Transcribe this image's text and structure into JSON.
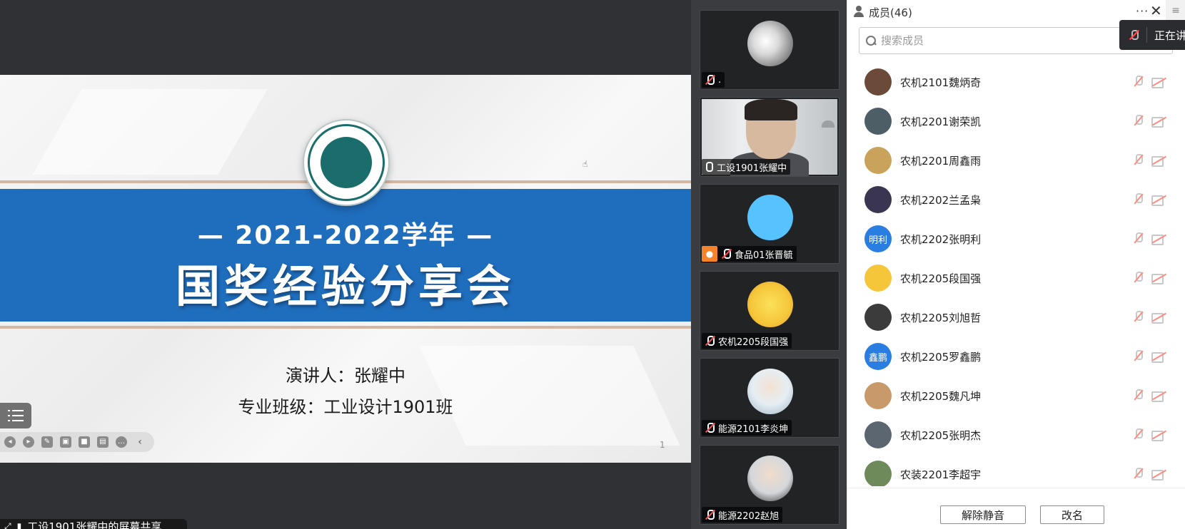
{
  "slide": {
    "year_line": "— 2021-2022学年 —",
    "title": "国奖经验分享会",
    "speaker": "演讲人：张耀中",
    "class": "专业班级：工业设计1901班",
    "page_number": "1"
  },
  "share_label": "工设1901张耀中的屏幕共享",
  "video_tiles": [
    {
      "name": ".",
      "mic": "muted",
      "avatar_color": "#cfcfcf"
    },
    {
      "name": "工设1901张耀中",
      "mic": "on",
      "video": true
    },
    {
      "name": "食品01张晋毓",
      "mic": "muted",
      "avatar_color": "#56c3ff",
      "badge": "person"
    },
    {
      "name": "农机2205段国强",
      "mic": "muted",
      "avatar_color": "#f5c63a"
    },
    {
      "name": "能源2101李炎坤",
      "mic": "muted",
      "avatar_color": "#e6eef3"
    },
    {
      "name": "能源2202赵旭",
      "mic": "muted",
      "avatar_color": "#d4d7db"
    }
  ],
  "members_panel": {
    "title": "成员(46)",
    "search_placeholder": "搜索成员",
    "toast_text": "正在讲",
    "members": [
      {
        "name": "农机2101魏炳奇",
        "avatar_color": "#6b4a3a",
        "initials": ""
      },
      {
        "name": "农机2201谢荣凯",
        "avatar_color": "#4e5e66",
        "initials": ""
      },
      {
        "name": "农机2201周鑫雨",
        "avatar_color": "#c9a35c",
        "initials": ""
      },
      {
        "name": "农机2202兰孟枭",
        "avatar_color": "#3a3550",
        "initials": ""
      },
      {
        "name": "农机2202张明利",
        "avatar_color": "#2a7de1",
        "initials": "明利"
      },
      {
        "name": "农机2205段国强",
        "avatar_color": "#f5c63a",
        "initials": ""
      },
      {
        "name": "农机2205刘旭哲",
        "avatar_color": "#3b3b3b",
        "initials": ""
      },
      {
        "name": "农机2205罗鑫鹏",
        "avatar_color": "#2a7de1",
        "initials": "鑫鹏"
      },
      {
        "name": "农机2205魏凡坤",
        "avatar_color": "#c89a6a",
        "initials": ""
      },
      {
        "name": "农机2205张明杰",
        "avatar_color": "#5b6670",
        "initials": ""
      },
      {
        "name": "农装2201李超宇",
        "avatar_color": "#6e8a5a",
        "initials": ""
      }
    ],
    "buttons": {
      "unmute_all": "解除静音",
      "rename": "改名"
    }
  }
}
